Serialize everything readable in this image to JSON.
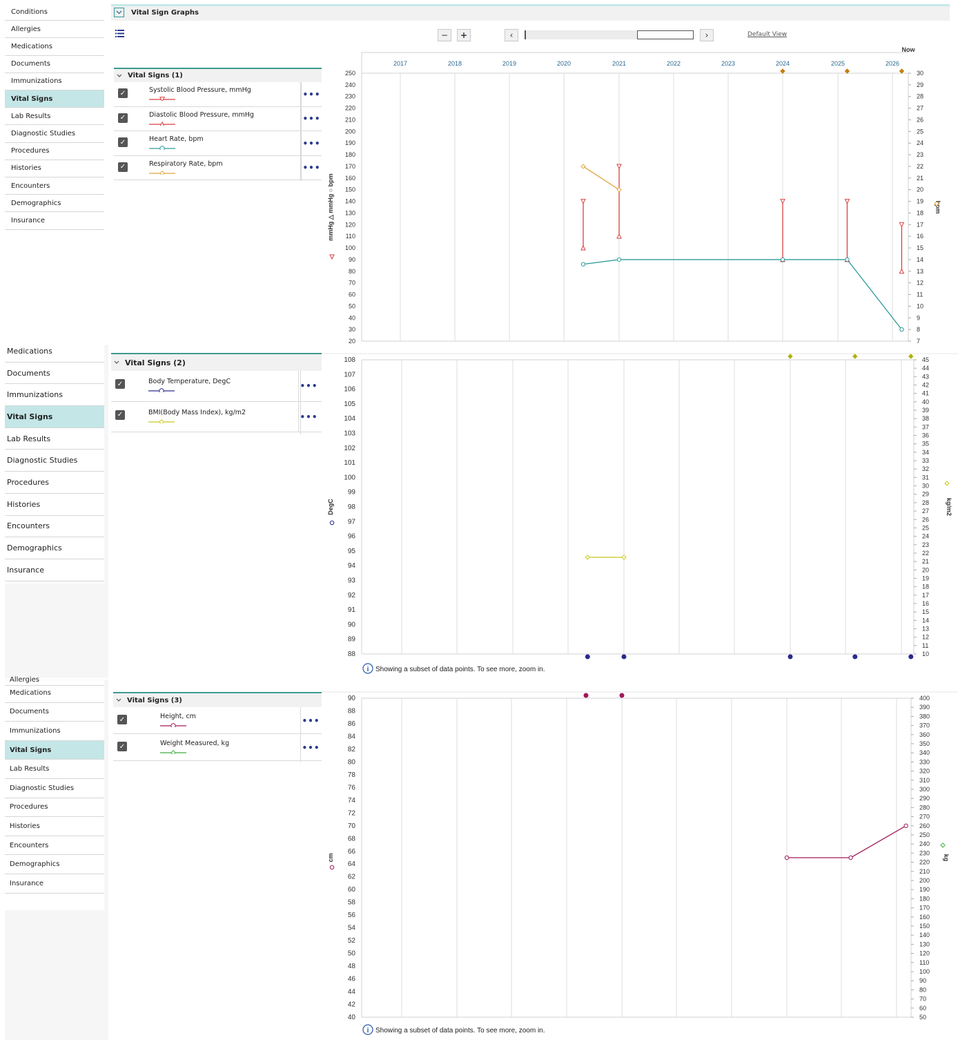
{
  "sidebar1": {
    "items": [
      {
        "label": "Conditions",
        "active": false
      },
      {
        "label": "Allergies",
        "active": false
      },
      {
        "label": "Medications",
        "active": false
      },
      {
        "label": "Documents",
        "active": false
      },
      {
        "label": "Immunizations",
        "active": false
      },
      {
        "label": "Vital Signs",
        "active": true
      },
      {
        "label": "Lab Results",
        "active": false
      },
      {
        "label": "Diagnostic Studies",
        "active": false
      },
      {
        "label": "Procedures",
        "active": false
      },
      {
        "label": "Histories",
        "active": false
      },
      {
        "label": "Encounters",
        "active": false
      },
      {
        "label": "Demographics",
        "active": false
      },
      {
        "label": "Insurance",
        "active": false
      }
    ]
  },
  "sidebar2": {
    "items": [
      {
        "label": "Medications",
        "active": false
      },
      {
        "label": "Documents",
        "active": false
      },
      {
        "label": "Immunizations",
        "active": false
      },
      {
        "label": "Vital Signs",
        "active": true
      },
      {
        "label": "Lab Results",
        "active": false
      },
      {
        "label": "Diagnostic Studies",
        "active": false
      },
      {
        "label": "Procedures",
        "active": false
      },
      {
        "label": "Histories",
        "active": false
      },
      {
        "label": "Encounters",
        "active": false
      },
      {
        "label": "Demographics",
        "active": false
      },
      {
        "label": "Insurance",
        "active": false
      }
    ]
  },
  "sidebar3": {
    "partial_label": "Allergies",
    "items": [
      {
        "label": "Medications",
        "active": false
      },
      {
        "label": "Documents",
        "active": false
      },
      {
        "label": "Immunizations",
        "active": false
      },
      {
        "label": "Vital Signs",
        "active": true
      },
      {
        "label": "Lab Results",
        "active": false
      },
      {
        "label": "Diagnostic Studies",
        "active": false
      },
      {
        "label": "Procedures",
        "active": false
      },
      {
        "label": "Histories",
        "active": false
      },
      {
        "label": "Encounters",
        "active": false
      },
      {
        "label": "Demographics",
        "active": false
      },
      {
        "label": "Insurance",
        "active": false
      }
    ]
  },
  "header": {
    "title": "Vital Sign Graphs",
    "collapse_icon": "chevron-down-icon"
  },
  "toolbar": {
    "zoom_out": "−",
    "zoom_in": "+",
    "prev": "‹",
    "next": "›",
    "default_view": "Default View",
    "list_icon": "list-icon"
  },
  "timeline": {
    "years": [
      "2017",
      "2018",
      "2019",
      "2020",
      "2021",
      "2022",
      "2023",
      "2024",
      "2025",
      "2026"
    ],
    "now_label": "Now"
  },
  "groups": [
    {
      "title": "Vital Signs (1)",
      "items": [
        {
          "label": "Systolic Blood Pressure, mmHg",
          "color": "#d93f3f",
          "marker": "triangle-down",
          "checked": true
        },
        {
          "label": "Diastolic Blood Pressure, mmHg",
          "color": "#d93f3f",
          "marker": "triangle-up",
          "checked": true
        },
        {
          "label": "Heart Rate, bpm",
          "color": "#2f9a9a",
          "marker": "circle",
          "checked": true
        },
        {
          "label": "Respiratory Rate, bpm",
          "color": "#e0a33c",
          "marker": "diamond",
          "checked": true
        }
      ]
    },
    {
      "title": "Vital Signs (2)",
      "items": [
        {
          "label": "Body Temperature, DegC",
          "color": "#2a2a8f",
          "marker": "circle",
          "checked": true
        },
        {
          "label": "BMI(Body Mass Index), kg/m2",
          "color": "#c8c81e",
          "marker": "diamond",
          "checked": true
        }
      ]
    },
    {
      "title": "Vital Signs (3)",
      "items": [
        {
          "label": "Height, cm",
          "color": "#a0195a",
          "marker": "circle",
          "checked": true
        },
        {
          "label": "Weight Measured, kg",
          "color": "#3fae3f",
          "marker": "diamond",
          "checked": true
        }
      ]
    }
  ],
  "subset_note": "Showing a subset of data points. To see more, zoom in.",
  "chart_data": [
    {
      "type": "line",
      "title": "Vital Signs (1)",
      "x_axis": {
        "min": "2016.3",
        "max": "2026.25",
        "ticks": [
          "2017",
          "2018",
          "2019",
          "2020",
          "2021",
          "2022",
          "2023",
          "2024",
          "2025",
          "2026"
        ]
      },
      "ylim": [
        20,
        250
      ],
      "yticks_step": 10,
      "ylabel": "mmHg △ mmHg ○ bpm",
      "y2lim": [
        7,
        30
      ],
      "y2ticks_step": 1,
      "y2label": "bpm",
      "series": [
        {
          "name": "Systolic Blood Pressure, mmHg",
          "axis": "left",
          "points": [
            [
              2020.35,
              140
            ],
            [
              2021.0,
              170
            ],
            [
              2024.0,
              140
            ],
            [
              2025.17,
              140
            ],
            [
              2026.17,
              120
            ]
          ]
        },
        {
          "name": "Diastolic Blood Pressure, mmHg",
          "axis": "left",
          "points": [
            [
              2020.35,
              100
            ],
            [
              2021.0,
              110
            ],
            [
              2024.0,
              90
            ],
            [
              2025.17,
              90
            ],
            [
              2026.17,
              80
            ]
          ]
        },
        {
          "name": "Heart Rate, bpm",
          "axis": "left",
          "points": [
            [
              2020.35,
              86
            ],
            [
              2021.0,
              90
            ],
            [
              2024.0,
              90
            ],
            [
              2025.17,
              90
            ],
            [
              2026.17,
              30
            ]
          ]
        },
        {
          "name": "Respiratory Rate, bpm",
          "axis": "right",
          "points": [
            [
              2020.35,
              22
            ],
            [
              2021.0,
              20
            ]
          ]
        }
      ],
      "offscale_markers": [
        2024.0,
        2025.17,
        2026.17
      ]
    },
    {
      "type": "line",
      "title": "Vital Signs (2)",
      "ylim": [
        88,
        108
      ],
      "yticks_step": 1,
      "ylabel": "DegC",
      "y2lim": [
        10,
        45
      ],
      "y2ticks_step": 1,
      "y2label": "kg/m2",
      "series": [
        {
          "name": "Body Temperature, DegC",
          "axis": "left",
          "points": []
        },
        {
          "name": "BMI(Body Mass Index), kg/m2",
          "axis": "right",
          "points": [
            [
              2020.35,
              21.5
            ],
            [
              2021.0,
              21.5
            ]
          ]
        }
      ],
      "offscale_high": [
        2024.0,
        2025.17,
        2026.17
      ],
      "offscale_low": [
        2020.35,
        2021.0,
        2024.0,
        2025.17,
        2026.17
      ]
    },
    {
      "type": "line",
      "title": "Vital Signs (3)",
      "ylim": [
        40,
        90
      ],
      "yticks_step": 2,
      "ylabel": "cm",
      "y2lim": [
        50,
        400
      ],
      "y2ticks_step": 10,
      "y2label": "kg",
      "series": [
        {
          "name": "Height, cm",
          "axis": "left",
          "points": [
            [
              2024.0,
              65
            ],
            [
              2025.17,
              65
            ],
            [
              2026.17,
              70
            ]
          ]
        },
        {
          "name": "Weight Measured, kg",
          "axis": "right",
          "points": []
        }
      ],
      "offscale_high": [
        2020.35,
        2021.0
      ]
    }
  ]
}
